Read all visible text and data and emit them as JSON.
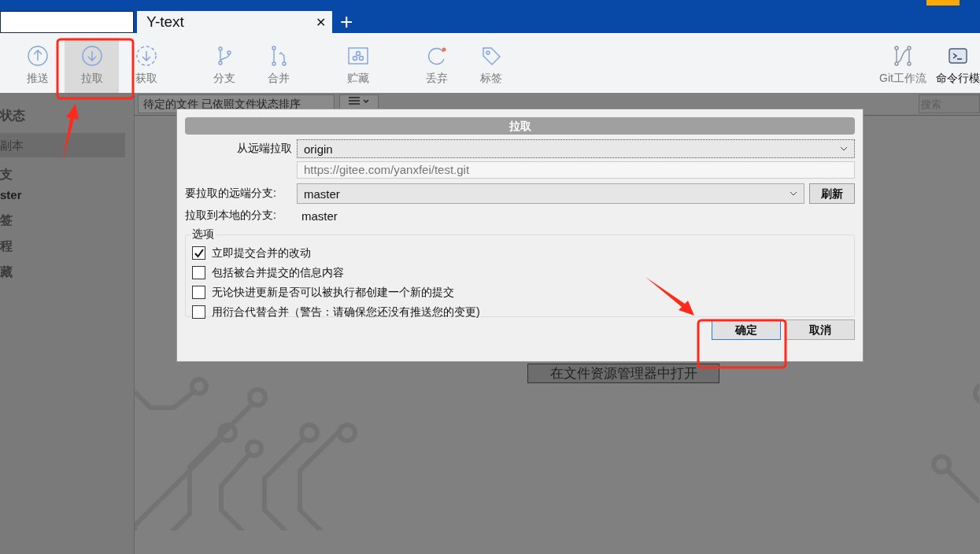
{
  "tabs": [
    {
      "label": "Y-text",
      "close": "✕",
      "selected": true
    }
  ],
  "new_tab": "+",
  "toolbar": {
    "groups": [
      [
        {
          "label": "推送",
          "selected": false
        },
        {
          "label": "拉取",
          "selected": true
        },
        {
          "label": "获取",
          "selected": false
        }
      ],
      [
        {
          "label": "分支",
          "selected": false
        },
        {
          "label": "合并",
          "selected": false
        }
      ],
      [
        {
          "label": "贮藏",
          "selected": false
        }
      ],
      [
        {
          "label": "丢弃",
          "selected": false
        },
        {
          "label": "标签",
          "selected": false
        }
      ]
    ],
    "right": [
      {
        "label": "Git工作流",
        "selected": false
      },
      {
        "label": "命令行模",
        "selected": false
      }
    ]
  },
  "sidebar": [
    {
      "label": "状态",
      "kind": "header",
      "selected": false
    },
    {
      "label": "副本",
      "kind": "item",
      "selected": true
    },
    {
      "label": "支",
      "kind": "header",
      "selected": false
    },
    {
      "label": "ster",
      "kind": "branch",
      "selected": false
    },
    {
      "label": "签",
      "kind": "header",
      "selected": false
    },
    {
      "label": "程",
      "kind": "header",
      "selected": false
    },
    {
      "label": "藏",
      "kind": "header",
      "selected": false
    }
  ],
  "filter": {
    "sort": "待定的文件 已依照文件状态排序",
    "search_placeholder": "搜索"
  },
  "open_in_explorer": "在文件资源管理器中打开",
  "dialog": {
    "title": "拉取",
    "remote_label": "从远端拉取",
    "remote": "origin",
    "remote_url": "https://gitee.com/yanxfei/test.git",
    "branch_label": "要拉取的远端分支:",
    "branch": "master",
    "refresh": "刷新",
    "local_label": "拉取到本地的分支:",
    "local": "master",
    "options_title": "选项",
    "options": [
      {
        "label": "立即提交合并的改动",
        "checked": true
      },
      {
        "label": "包括被合并提交的信息内容",
        "checked": false
      },
      {
        "label": "无论快进更新是否可以被执行都创建一个新的提交",
        "checked": false
      },
      {
        "label": "用衍合代替合并（警告：请确保您还没有推送您的变更)",
        "checked": false
      }
    ],
    "buttons": [
      {
        "label": "确定",
        "default": true
      },
      {
        "label": "取消",
        "default": false
      }
    ]
  }
}
